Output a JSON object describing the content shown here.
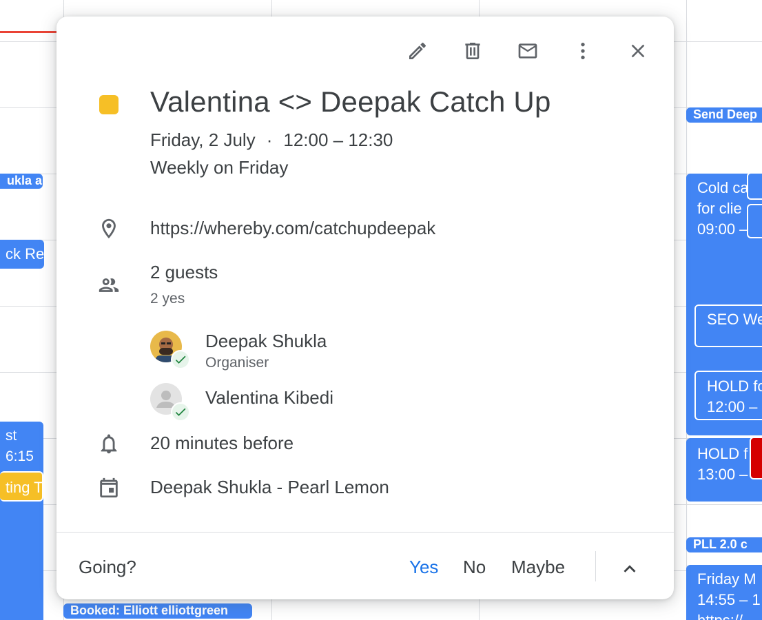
{
  "calendar_bg": {
    "events": {
      "left_1": "ukla a",
      "left_2": "ck Ren",
      "left_3_line1": "st",
      "left_3_line2": "6:15",
      "left_4": "ting T",
      "bottom": "Booked: Elliott elliottgreen",
      "right_1": "Send Deep",
      "right_2_line1": "Cold ca",
      "right_2_line2": "for clie",
      "right_2_line3": "09:00 –",
      "right_3": "SEO We",
      "right_4_line1": "HOLD fo",
      "right_4_line2": "12:00 –",
      "right_5_line1": "HOLD f",
      "right_5_line2": "13:00 –",
      "right_6": "PLL 2.0 c",
      "right_7_line1": "Friday M",
      "right_7_line2": "14:55 – 1",
      "right_7_line3": "https://"
    }
  },
  "toolbar": {
    "icons": [
      "edit-icon",
      "delete-icon",
      "email-icon",
      "more-vert-icon",
      "close-icon"
    ]
  },
  "event": {
    "color": "#f6bf26",
    "title": "Valentina <> Deepak Catch Up",
    "date": "Friday, 2 July",
    "separator": "·",
    "time": "12:00 – 12:30",
    "recurrence": "Weekly on Friday",
    "location": "https://whereby.com/catchupdeepak",
    "guests_title": "2 guests",
    "guests_summary": "2 yes",
    "guests": [
      {
        "name": "Deepak Shukla",
        "role": "Organiser"
      },
      {
        "name": "Valentina Kibedi",
        "role": ""
      }
    ],
    "reminder": "20 minutes before",
    "calendar": "Deepak Shukla - Pearl Lemon"
  },
  "footer": {
    "question": "Going?",
    "yes": "Yes",
    "no": "No",
    "maybe": "Maybe"
  },
  "colors": {
    "accent": "#1a73e8",
    "event_blue": "#4285f4",
    "accepted_green": "#188038"
  }
}
